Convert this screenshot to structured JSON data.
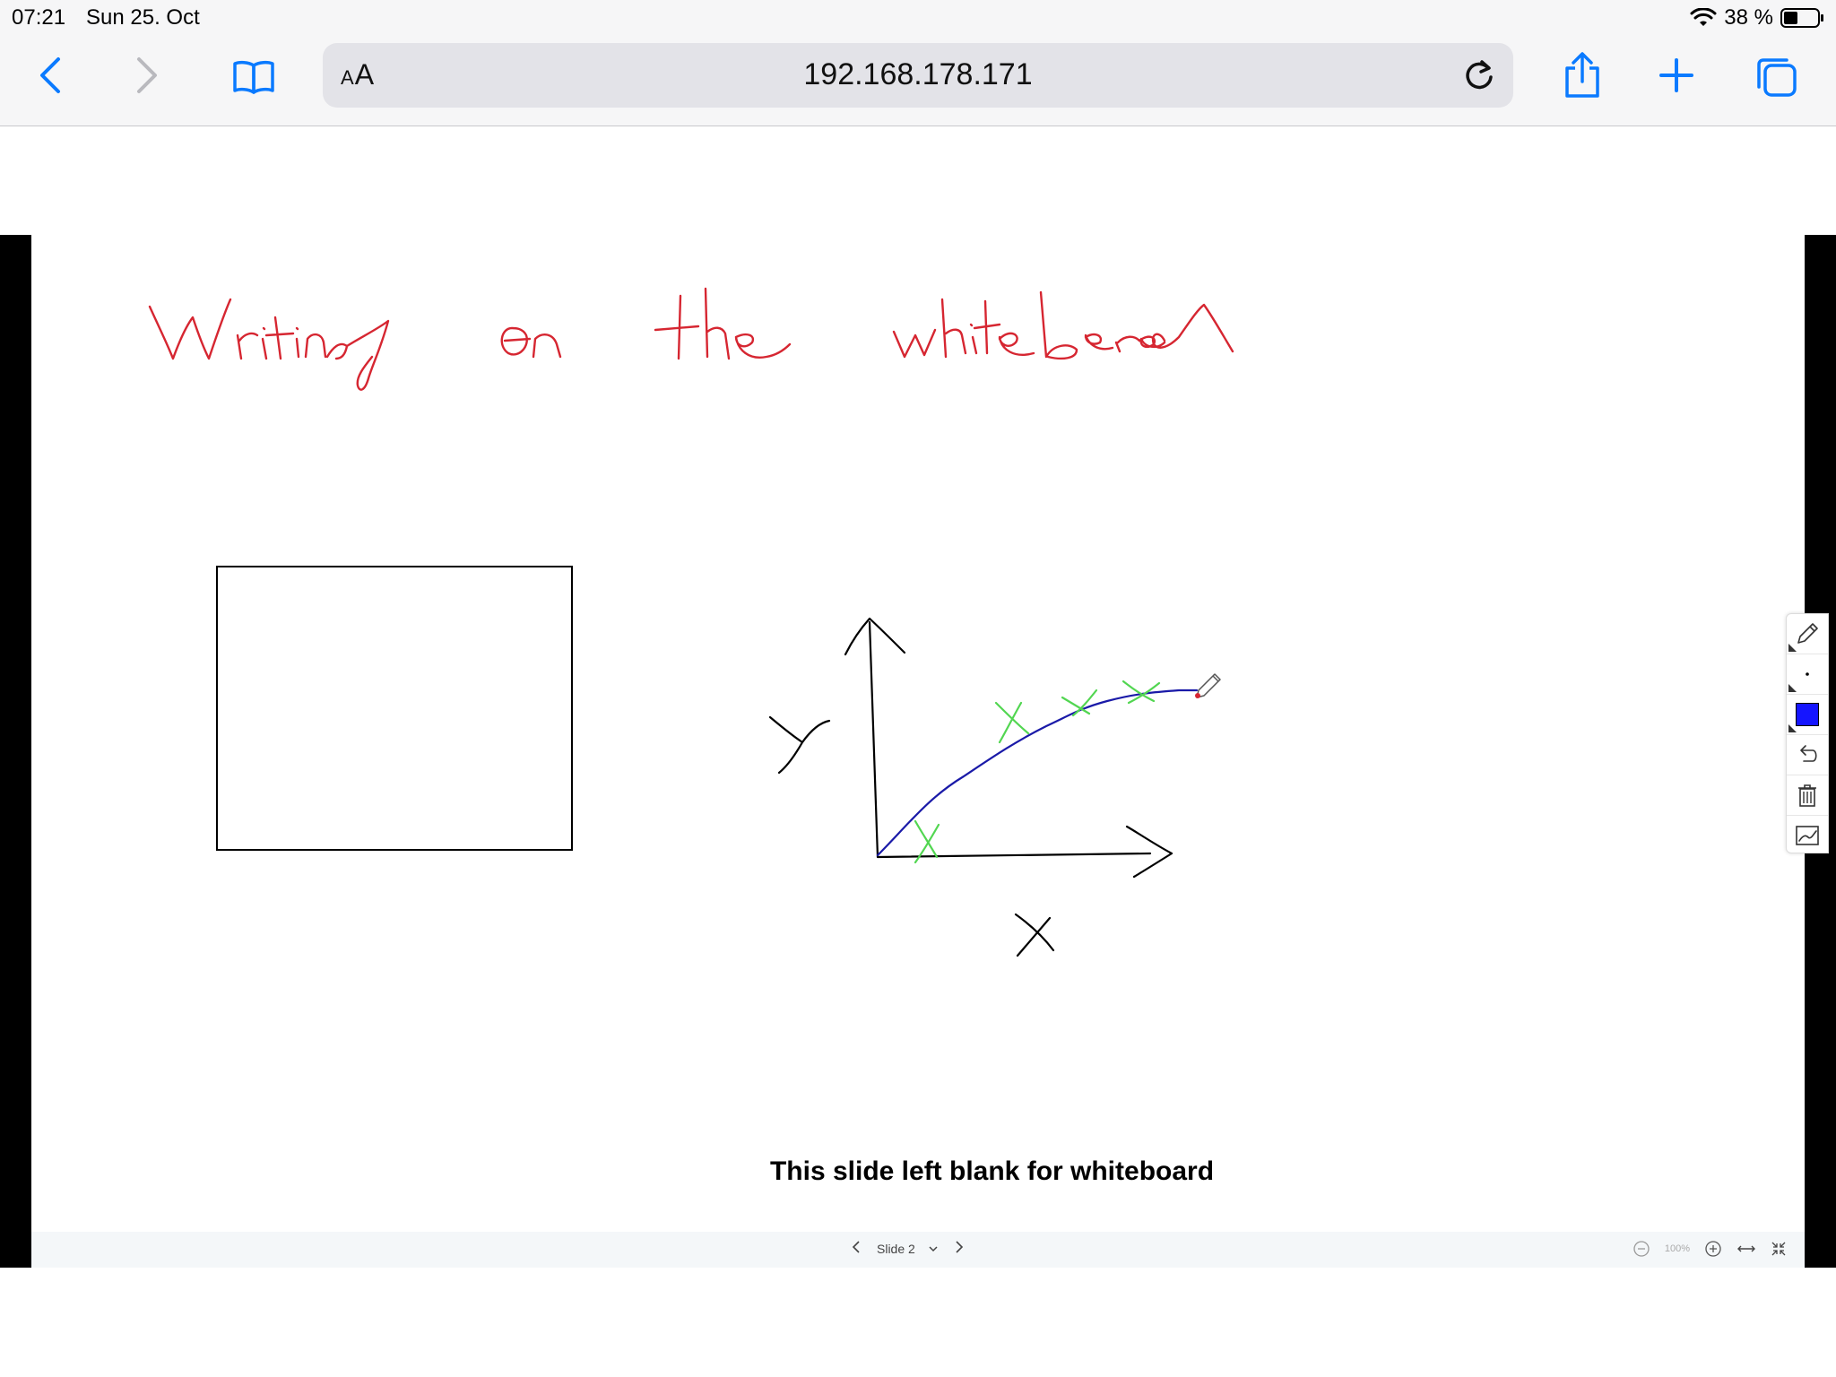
{
  "status_bar": {
    "time": "07:21",
    "date": "Sun 25. Oct",
    "battery": "38 %"
  },
  "browser": {
    "url": "192.168.178.171",
    "reader_small": "A",
    "reader_large": "A",
    "icons": [
      "back-icon",
      "forward-icon",
      "bookmarks-icon",
      "reload-icon",
      "share-icon",
      "new-tab-icon",
      "tabs-icon"
    ]
  },
  "slide": {
    "caption": "This slide left blank for whiteboard",
    "handwriting": "Writing on the whiteboard",
    "handwriting_color": "#d62631",
    "axis_label_x": "X",
    "axis_label_y": "Y",
    "curve_color": "#1a1aa8",
    "marker_color": "#52d651"
  },
  "slide_nav": {
    "label": "Slide 2",
    "zoom": "100%"
  },
  "tool_palette": {
    "tools": [
      "pencil-icon",
      "point-size-icon",
      "color-swatch",
      "undo-icon",
      "trash-icon",
      "chart-icon"
    ],
    "active_color": "#1515ff"
  }
}
